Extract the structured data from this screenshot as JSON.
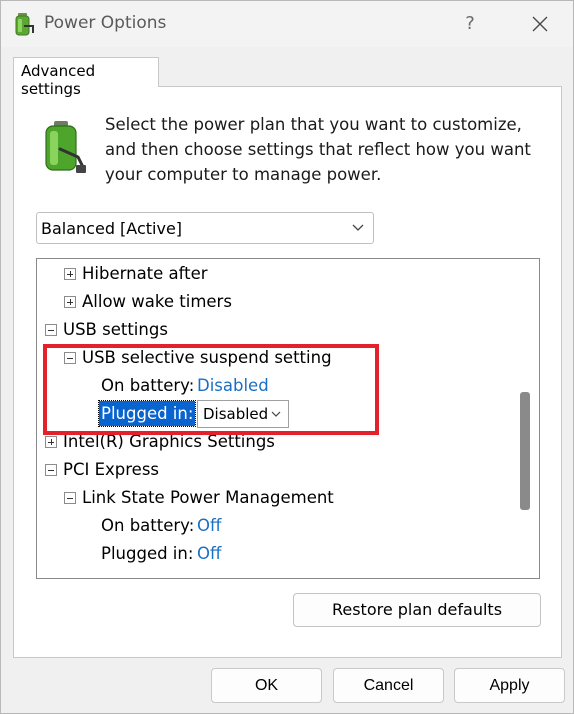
{
  "window": {
    "title": "Power Options",
    "help_glyph": "?",
    "close_glyph": "✕"
  },
  "tab": {
    "label": "Advanced settings"
  },
  "intro_text": "Select the power plan that you want to customize, and then choose settings that reflect how you want your computer to manage power.",
  "plan_select": {
    "value": "Balanced [Active]"
  },
  "tree": {
    "items": [
      {
        "label": "Hibernate after",
        "toggle": "plus",
        "level": 1
      },
      {
        "label": "Allow wake timers",
        "toggle": "plus",
        "level": 1
      },
      {
        "label": "USB settings",
        "toggle": "minus",
        "level": 0
      },
      {
        "label": "USB selective suspend setting",
        "toggle": "minus",
        "level": 1
      },
      {
        "label": "On battery:",
        "value": "Disabled",
        "level": 2
      },
      {
        "label": "Plugged in:",
        "value": "Disabled",
        "level": 2,
        "selected": true
      },
      {
        "label": "Intel(R) Graphics Settings",
        "toggle": "plus",
        "level": 0
      },
      {
        "label": "PCI Express",
        "toggle": "minus",
        "level": 0
      },
      {
        "label": "Link State Power Management",
        "toggle": "minus",
        "level": 1
      },
      {
        "label": "On battery:",
        "value": "Off",
        "level": 2
      },
      {
        "label": "Plugged in:",
        "value": "Off",
        "level": 2
      }
    ]
  },
  "buttons": {
    "restore": "Restore plan defaults",
    "ok": "OK",
    "cancel": "Cancel",
    "apply": "Apply"
  },
  "colors": {
    "link_value": "#1a6fc4",
    "selection": "#0a64ce",
    "highlight_box": "#e4202a"
  }
}
